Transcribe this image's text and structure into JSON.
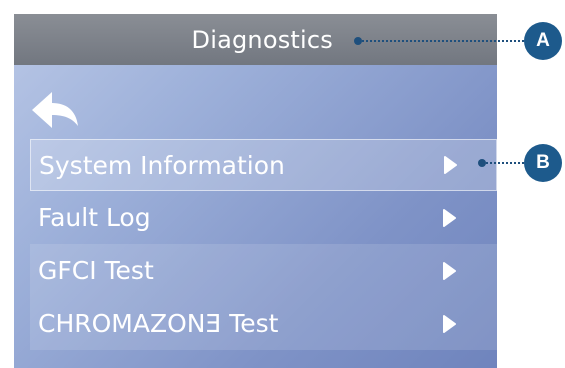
{
  "screen": {
    "title": "Diagnostics",
    "back_icon": "back-arrow-icon"
  },
  "menu": {
    "items": [
      {
        "label": "System Information",
        "selected": true
      },
      {
        "label": "Fault Log"
      },
      {
        "label": "GFCI Test"
      },
      {
        "label": "CHROMAZONƎ Test"
      }
    ],
    "arrow_icon": "play-arrow-icon"
  },
  "callouts": [
    {
      "label": "A"
    },
    {
      "label": "B"
    }
  ],
  "colors": {
    "title_bar": "#7d828a",
    "screen_background": "#8ea2d2",
    "callout": "#1d5a8c",
    "text": "#ffffff"
  }
}
